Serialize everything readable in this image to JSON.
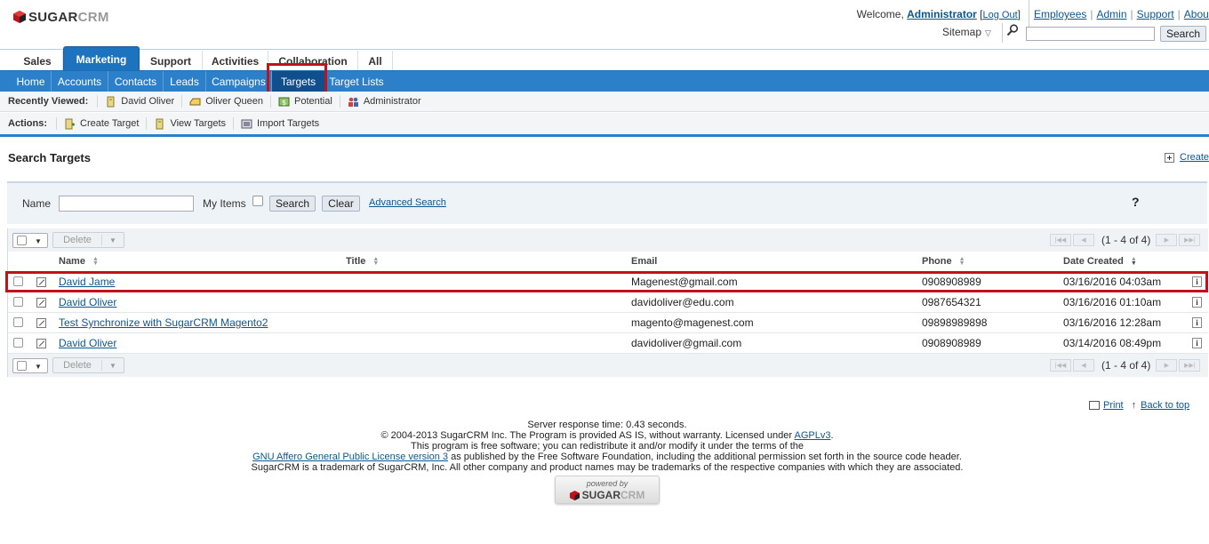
{
  "brand": {
    "logo_main": "SUGAR",
    "logo_crm": "CRM"
  },
  "header": {
    "welcome_prefix": "Welcome,",
    "user": "Administrator",
    "logout_open": "[",
    "logout": "Log Out",
    "logout_close": "]",
    "top_links": [
      "Employees",
      "Admin",
      "Support",
      "About"
    ],
    "sitemap": "Sitemap",
    "search_button": "Search",
    "search_value": ""
  },
  "group_tabs": [
    "Sales",
    "Marketing",
    "Support",
    "Activities",
    "Collaboration",
    "All"
  ],
  "module_tabs": [
    "Home",
    "Accounts",
    "Contacts",
    "Leads",
    "Campaigns",
    "Targets",
    "Target Lists"
  ],
  "active_group": "Marketing",
  "active_module": "Targets",
  "recently_viewed": {
    "label": "Recently Viewed:",
    "items": [
      "David Oliver",
      "Oliver Queen",
      "Potential",
      "Administrator"
    ]
  },
  "actions": {
    "label": "Actions:",
    "items": [
      "Create Target",
      "View Targets",
      "Import Targets"
    ]
  },
  "page": {
    "title": "Search Targets",
    "create_link": "Create"
  },
  "search_form": {
    "name_label": "Name",
    "name_value": "",
    "my_items_label": "My Items",
    "search_button": "Search",
    "clear_button": "Clear",
    "advanced_link": "Advanced Search",
    "help": "?"
  },
  "list": {
    "delete_button": "Delete",
    "pagination_text": "(1 - 4 of 4)",
    "columns": [
      "Name",
      "Title",
      "Email",
      "Phone",
      "Date Created"
    ],
    "rows": [
      {
        "name": "David Jame",
        "title": "",
        "email": "Magenest@gmail.com",
        "phone": "0908908989",
        "date": "03/16/2016 04:03am"
      },
      {
        "name": "David Oliver",
        "title": "",
        "email": "davidoliver@edu.com",
        "phone": "0987654321",
        "date": "03/16/2016 01:10am"
      },
      {
        "name": "Test Synchronize with SugarCRM Magento2",
        "title": "",
        "email": "magento@magenest.com",
        "phone": "09898989898",
        "date": "03/16/2016 12:28am"
      },
      {
        "name": "David Oliver",
        "title": "",
        "email": "davidoliver@gmail.com",
        "phone": "0908908989",
        "date": "03/14/2016 08:49pm"
      }
    ]
  },
  "page_links": {
    "print": "Print",
    "back_to_top": "Back to top"
  },
  "footer": {
    "line1": "Server response time: 0.43 seconds.",
    "line2_pre": "© 2004-2013 SugarCRM Inc. The Program is provided AS IS, without warranty. Licensed under ",
    "line2_link": "AGPLv3",
    "line2_post": ".",
    "line3": "This program is free software; you can redistribute it and/or modify it under the terms of the",
    "line4_link": "GNU Affero General Public License version 3",
    "line4_post": " as published by the Free Software Foundation, including the additional permission set forth in the source code header.",
    "line5": "SugarCRM is a trademark of SugarCRM, Inc. All other company and product names may be trademarks of the respective companies with which they are associated.",
    "powered_by": "powered by"
  },
  "colors": {
    "accent": "#1e73bf",
    "highlight": "#c1121c",
    "link": "#0b578f"
  }
}
